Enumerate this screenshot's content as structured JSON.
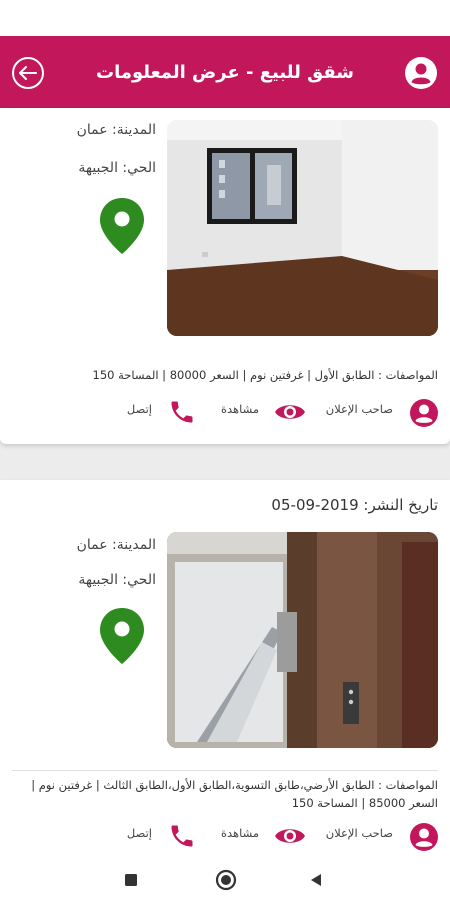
{
  "header": {
    "title": "شقق للبيع - عرض المعلومات"
  },
  "listings": [
    {
      "city_label": "المدينة: عمان",
      "district_label": "الحي: الجبيهة",
      "specs": "المواصفات : الطابق الأول | غرفتين نوم | السعر 80000 | المساحة 150",
      "actions": {
        "owner": "صاحب الإعلان",
        "view": "مشاهدة",
        "call": "إتصل"
      }
    },
    {
      "date": "تاريخ النشر: 2019-09-05",
      "city_label": "المدينة: عمان",
      "district_label": "الحي: الجبيهة",
      "specs": "المواصفات : الطابق الأرضي،طابق التسوية،الطابق الأول،الطابق الثالث | غرفتين نوم | السعر 85000 | المساحة 150",
      "actions": {
        "owner": "صاحب الإعلان",
        "view": "مشاهدة",
        "call": "إتصل"
      }
    }
  ],
  "colors": {
    "primary": "#c2185b",
    "pin": "#2e8b1f",
    "icon": "#c2185b"
  },
  "icons": {
    "back": "back-arrow-icon",
    "profile": "account-circle-icon",
    "location": "location-pin-icon",
    "owner": "account-circle-icon",
    "view": "eye-icon",
    "call": "phone-icon"
  }
}
